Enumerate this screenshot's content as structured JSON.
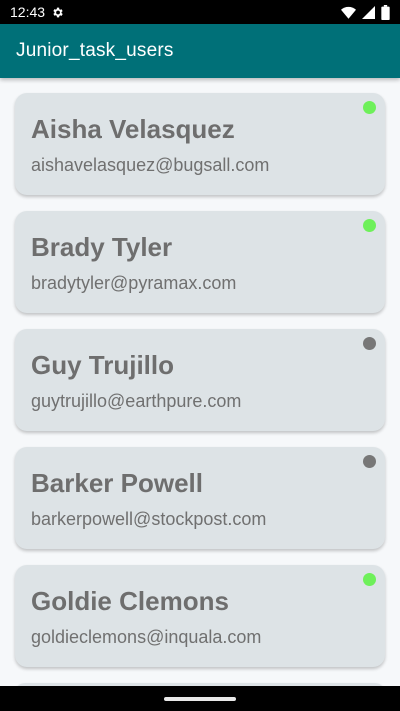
{
  "status_bar": {
    "time": "12:43",
    "icons": [
      "gear-icon",
      "wifi-icon",
      "signal-icon",
      "battery-icon"
    ]
  },
  "app_bar": {
    "title": "Junior_task_users",
    "background": "#007078"
  },
  "colors": {
    "online": "#6ef05a",
    "offline": "#777777",
    "card": "#dde3e6"
  },
  "users": [
    {
      "name": "Aisha Velasquez",
      "email": "aishavelasquez@bugsall.com",
      "status": "online"
    },
    {
      "name": "Brady Tyler",
      "email": "bradytyler@pyramax.com",
      "status": "online"
    },
    {
      "name": "Guy Trujillo",
      "email": "guytrujillo@earthpure.com",
      "status": "offline"
    },
    {
      "name": "Barker Powell",
      "email": "barkerpowell@stockpost.com",
      "status": "offline"
    },
    {
      "name": "Goldie Clemons",
      "email": "goldieclemons@inquala.com",
      "status": "online"
    }
  ]
}
